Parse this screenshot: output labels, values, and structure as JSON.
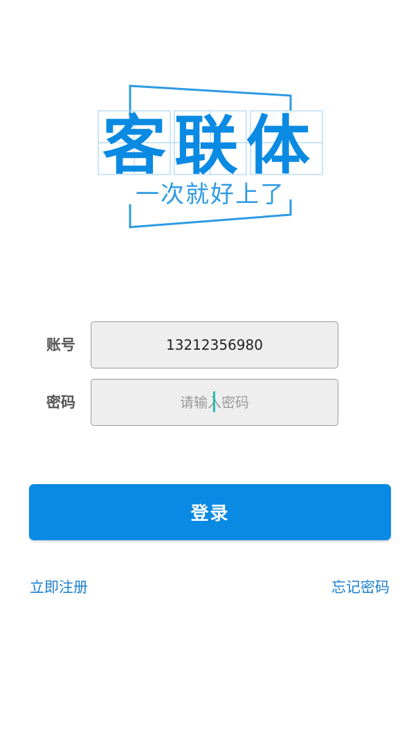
{
  "logo": {
    "title": "客联体",
    "slogan": "一次就好上了",
    "brand_color": "#0a8ae2"
  },
  "form": {
    "account": {
      "label": "账号",
      "value": "13212356980"
    },
    "password": {
      "label": "密码",
      "placeholder": "请输入密码",
      "value": ""
    }
  },
  "actions": {
    "login_label": "登录",
    "register_label": "立即注册",
    "forgot_label": "忘记密码"
  },
  "colors": {
    "accent": "#0a8ae2",
    "link": "#1a7fd0",
    "caret": "#1fbfb0"
  }
}
